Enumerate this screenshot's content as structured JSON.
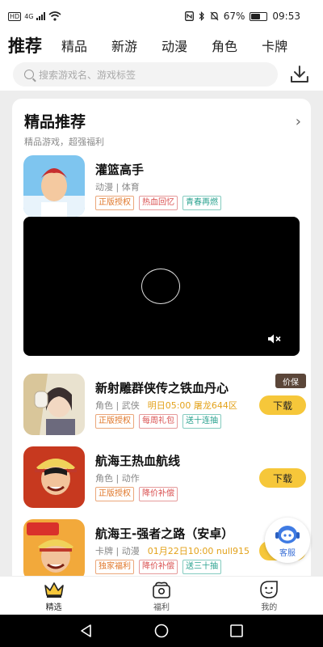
{
  "status_bar": {
    "network_left": "HD",
    "network_type": "4G",
    "battery": "67%",
    "battery_level": 0.67,
    "time": "09:53"
  },
  "tabs": [
    "推荐",
    "精品",
    "新游",
    "动漫",
    "角色",
    "卡牌"
  ],
  "active_tab": 0,
  "search": {
    "placeholder": "搜索游戏名、游戏标签"
  },
  "section": {
    "title": "精品推荐",
    "subtitle": "精品游戏，超强福利"
  },
  "games": [
    {
      "name": "灌篮高手",
      "meta": "动漫 | 体育",
      "highlight": "",
      "tags": [
        {
          "text": "正版授权",
          "color": "orange"
        },
        {
          "text": "热血回忆",
          "color": "red"
        },
        {
          "text": "青春再燃",
          "color": "teal"
        }
      ],
      "badge": "",
      "button": ""
    },
    {
      "name": "新射雕群侠传之铁血丹心",
      "meta": "角色 | 武侠",
      "highlight": "明日05:00  屠龙644区",
      "tags": [
        {
          "text": "正版授权",
          "color": "orange"
        },
        {
          "text": "每周礼包",
          "color": "red"
        },
        {
          "text": "送十连抽",
          "color": "teal"
        }
      ],
      "badge": "价保",
      "button": "下载"
    },
    {
      "name": "航海王热血航线",
      "meta": "角色 | 动作",
      "highlight": "",
      "tags": [
        {
          "text": "正版授权",
          "color": "orange"
        },
        {
          "text": "降价补偿",
          "color": "red"
        }
      ],
      "badge": "",
      "button": "下载"
    },
    {
      "name": "航海王-强者之路（安卓）",
      "meta": "卡牌 | 动漫",
      "highlight": "01月22日10:00  null915",
      "tags": [
        {
          "text": "独家福利",
          "color": "orange"
        },
        {
          "text": "降价补偿",
          "color": "red"
        },
        {
          "text": "送三十抽",
          "color": "teal"
        }
      ],
      "badge": "",
      "button": "下载"
    }
  ],
  "float_service": {
    "label": "客服"
  },
  "bottom_nav": [
    {
      "label": "精选",
      "icon": "crown-icon",
      "active": true
    },
    {
      "label": "福利",
      "icon": "gift-box-icon",
      "active": false
    },
    {
      "label": "我的",
      "icon": "smile-face-icon",
      "active": false
    }
  ],
  "colors": {
    "accent": "#f6c73a",
    "price_badge": "#5b4639",
    "highlight_text": "#e3a21a"
  }
}
